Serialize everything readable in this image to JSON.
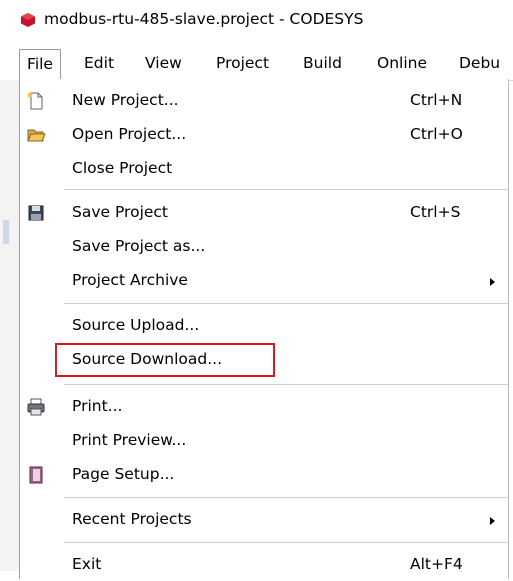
{
  "window": {
    "title": "modbus-rtu-485-slave.project - CODESYS"
  },
  "menubar": {
    "items": [
      "File",
      "Edit",
      "View",
      "Project",
      "Build",
      "Online",
      "Debu"
    ]
  },
  "file_menu": {
    "new_project": {
      "label": "New Project...",
      "shortcut": "Ctrl+N",
      "icon": "new-document-icon"
    },
    "open_project": {
      "label": "Open Project...",
      "shortcut": "Ctrl+O",
      "icon": "open-folder-icon"
    },
    "close_project": {
      "label": "Close Project"
    },
    "save_project": {
      "label": "Save Project",
      "shortcut": "Ctrl+S",
      "icon": "floppy-disk-icon"
    },
    "save_project_as": {
      "label": "Save Project as..."
    },
    "project_archive": {
      "label": "Project Archive",
      "has_submenu": true
    },
    "source_upload": {
      "label": "Source Upload..."
    },
    "source_download": {
      "label": "Source Download...",
      "highlighted": true
    },
    "print": {
      "label": "Print...",
      "icon": "printer-icon"
    },
    "print_preview": {
      "label": "Print Preview..."
    },
    "page_setup": {
      "label": "Page Setup...",
      "icon": "page-setup-icon"
    },
    "recent_projects": {
      "label": "Recent Projects",
      "has_submenu": true
    },
    "exit": {
      "label": "Exit",
      "shortcut": "Alt+F4"
    }
  },
  "colors": {
    "highlight_border": "#d71920",
    "app_icon": "#c8102e"
  }
}
